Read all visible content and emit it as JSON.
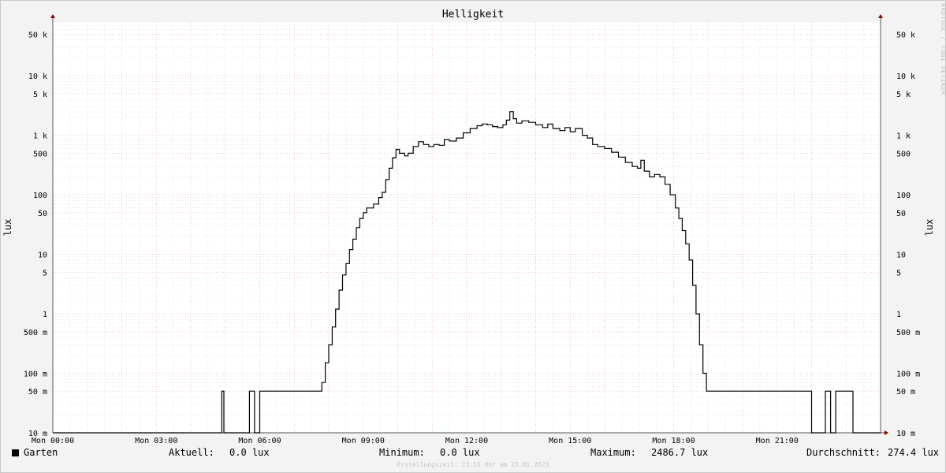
{
  "title": "Helligkeit",
  "watermark": "RRDTOOL / TOBI OETIKER",
  "footer": "Erstellungszeit: 23:55 Uhr am 23.01.2023",
  "colors": {
    "series": "#000000",
    "grid_major": "#f0b4b4",
    "grid_minor": "#d9d9d9",
    "axis": "#8b0000",
    "background": "#ffffff",
    "canvas": "#f3f3f3"
  },
  "legend": {
    "series_name": "Garten",
    "current_label": "Aktuell:",
    "current_value": "0.0 lux",
    "min_label": "Minimum:",
    "min_value": "0.0 lux",
    "max_label": "Maximum:",
    "max_value": "2486.7 lux",
    "avg_label": "Durchschnitt:",
    "avg_value": "274.4 lux"
  },
  "chart_data": {
    "type": "line",
    "title": "Helligkeit",
    "ylabel": "lux",
    "y_scale": "log",
    "ylim": [
      0.01,
      80000
    ],
    "xlim": [
      0,
      24
    ],
    "x_unit": "hours",
    "grid": true,
    "x_ticks": [
      {
        "x": 0,
        "label": "Mon 00:00"
      },
      {
        "x": 3,
        "label": "Mon 03:00"
      },
      {
        "x": 6,
        "label": "Mon 06:00"
      },
      {
        "x": 9,
        "label": "Mon 09:00"
      },
      {
        "x": 12,
        "label": "Mon 12:00"
      },
      {
        "x": 15,
        "label": "Mon 15:00"
      },
      {
        "x": 18,
        "label": "Mon 18:00"
      },
      {
        "x": 21,
        "label": "Mon 21:00"
      }
    ],
    "y_ticks": [
      {
        "y": 0.01,
        "label": "10 m"
      },
      {
        "y": 0.05,
        "label": "50 m"
      },
      {
        "y": 0.1,
        "label": "100 m"
      },
      {
        "y": 0.5,
        "label": "500 m"
      },
      {
        "y": 1,
        "label": "1"
      },
      {
        "y": 5,
        "label": "5"
      },
      {
        "y": 10,
        "label": "10"
      },
      {
        "y": 50,
        "label": "50"
      },
      {
        "y": 100,
        "label": "100"
      },
      {
        "y": 500,
        "label": "500"
      },
      {
        "y": 1000,
        "label": "1 k"
      },
      {
        "y": 5000,
        "label": "5 k"
      },
      {
        "y": 10000,
        "label": "10 k"
      },
      {
        "y": 50000,
        "label": "50 k"
      }
    ],
    "series": [
      {
        "name": "Garten",
        "points": [
          [
            0.0,
            0.01
          ],
          [
            4.9,
            0.01
          ],
          [
            4.9,
            0.05
          ],
          [
            4.96,
            0.05
          ],
          [
            4.96,
            0.01
          ],
          [
            5.7,
            0.01
          ],
          [
            5.7,
            0.05
          ],
          [
            5.85,
            0.05
          ],
          [
            5.85,
            0.01
          ],
          [
            6.0,
            0.01
          ],
          [
            6.0,
            0.05
          ],
          [
            7.7,
            0.05
          ],
          [
            7.8,
            0.07
          ],
          [
            7.9,
            0.15
          ],
          [
            8.0,
            0.3
          ],
          [
            8.1,
            0.6
          ],
          [
            8.2,
            1.2
          ],
          [
            8.3,
            2.5
          ],
          [
            8.4,
            4.5
          ],
          [
            8.5,
            7
          ],
          [
            8.6,
            12
          ],
          [
            8.7,
            18
          ],
          [
            8.8,
            28
          ],
          [
            8.9,
            40
          ],
          [
            9.0,
            50
          ],
          [
            9.1,
            60
          ],
          [
            9.3,
            70
          ],
          [
            9.45,
            90
          ],
          [
            9.55,
            110
          ],
          [
            9.65,
            180
          ],
          [
            9.75,
            280
          ],
          [
            9.85,
            420
          ],
          [
            9.95,
            580
          ],
          [
            10.05,
            500
          ],
          [
            10.2,
            450
          ],
          [
            10.3,
            500
          ],
          [
            10.45,
            650
          ],
          [
            10.6,
            780
          ],
          [
            10.75,
            700
          ],
          [
            10.9,
            650
          ],
          [
            11.05,
            700
          ],
          [
            11.2,
            680
          ],
          [
            11.35,
            850
          ],
          [
            11.5,
            800
          ],
          [
            11.7,
            900
          ],
          [
            11.9,
            1100
          ],
          [
            12.1,
            1300
          ],
          [
            12.3,
            1450
          ],
          [
            12.45,
            1550
          ],
          [
            12.6,
            1500
          ],
          [
            12.75,
            1400
          ],
          [
            12.9,
            1350
          ],
          [
            13.05,
            1500
          ],
          [
            13.15,
            1800
          ],
          [
            13.25,
            2490
          ],
          [
            13.35,
            1900
          ],
          [
            13.45,
            1600
          ],
          [
            13.6,
            1750
          ],
          [
            13.8,
            1650
          ],
          [
            14.0,
            1500
          ],
          [
            14.2,
            1350
          ],
          [
            14.35,
            1550
          ],
          [
            14.5,
            1300
          ],
          [
            14.7,
            1200
          ],
          [
            14.85,
            1350
          ],
          [
            15.0,
            1150
          ],
          [
            15.15,
            1300
          ],
          [
            15.35,
            1000
          ],
          [
            15.5,
            900
          ],
          [
            15.65,
            700
          ],
          [
            15.8,
            650
          ],
          [
            16.0,
            600
          ],
          [
            16.2,
            520
          ],
          [
            16.4,
            430
          ],
          [
            16.6,
            350
          ],
          [
            16.8,
            300
          ],
          [
            16.95,
            280
          ],
          [
            17.05,
            380
          ],
          [
            17.15,
            250
          ],
          [
            17.3,
            200
          ],
          [
            17.45,
            220
          ],
          [
            17.6,
            200
          ],
          [
            17.75,
            150
          ],
          [
            17.9,
            100
          ],
          [
            18.05,
            60
          ],
          [
            18.15,
            40
          ],
          [
            18.25,
            25
          ],
          [
            18.35,
            15
          ],
          [
            18.45,
            8
          ],
          [
            18.55,
            3
          ],
          [
            18.65,
            1
          ],
          [
            18.75,
            0.3
          ],
          [
            18.85,
            0.1
          ],
          [
            18.95,
            0.05
          ],
          [
            19.05,
            0.05
          ],
          [
            22.0,
            0.05
          ],
          [
            22.0,
            0.01
          ],
          [
            22.4,
            0.01
          ],
          [
            22.4,
            0.05
          ],
          [
            22.55,
            0.05
          ],
          [
            22.55,
            0.01
          ],
          [
            22.7,
            0.01
          ],
          [
            22.7,
            0.05
          ],
          [
            23.2,
            0.05
          ],
          [
            23.2,
            0.01
          ],
          [
            24.0,
            0.01
          ]
        ]
      }
    ]
  }
}
